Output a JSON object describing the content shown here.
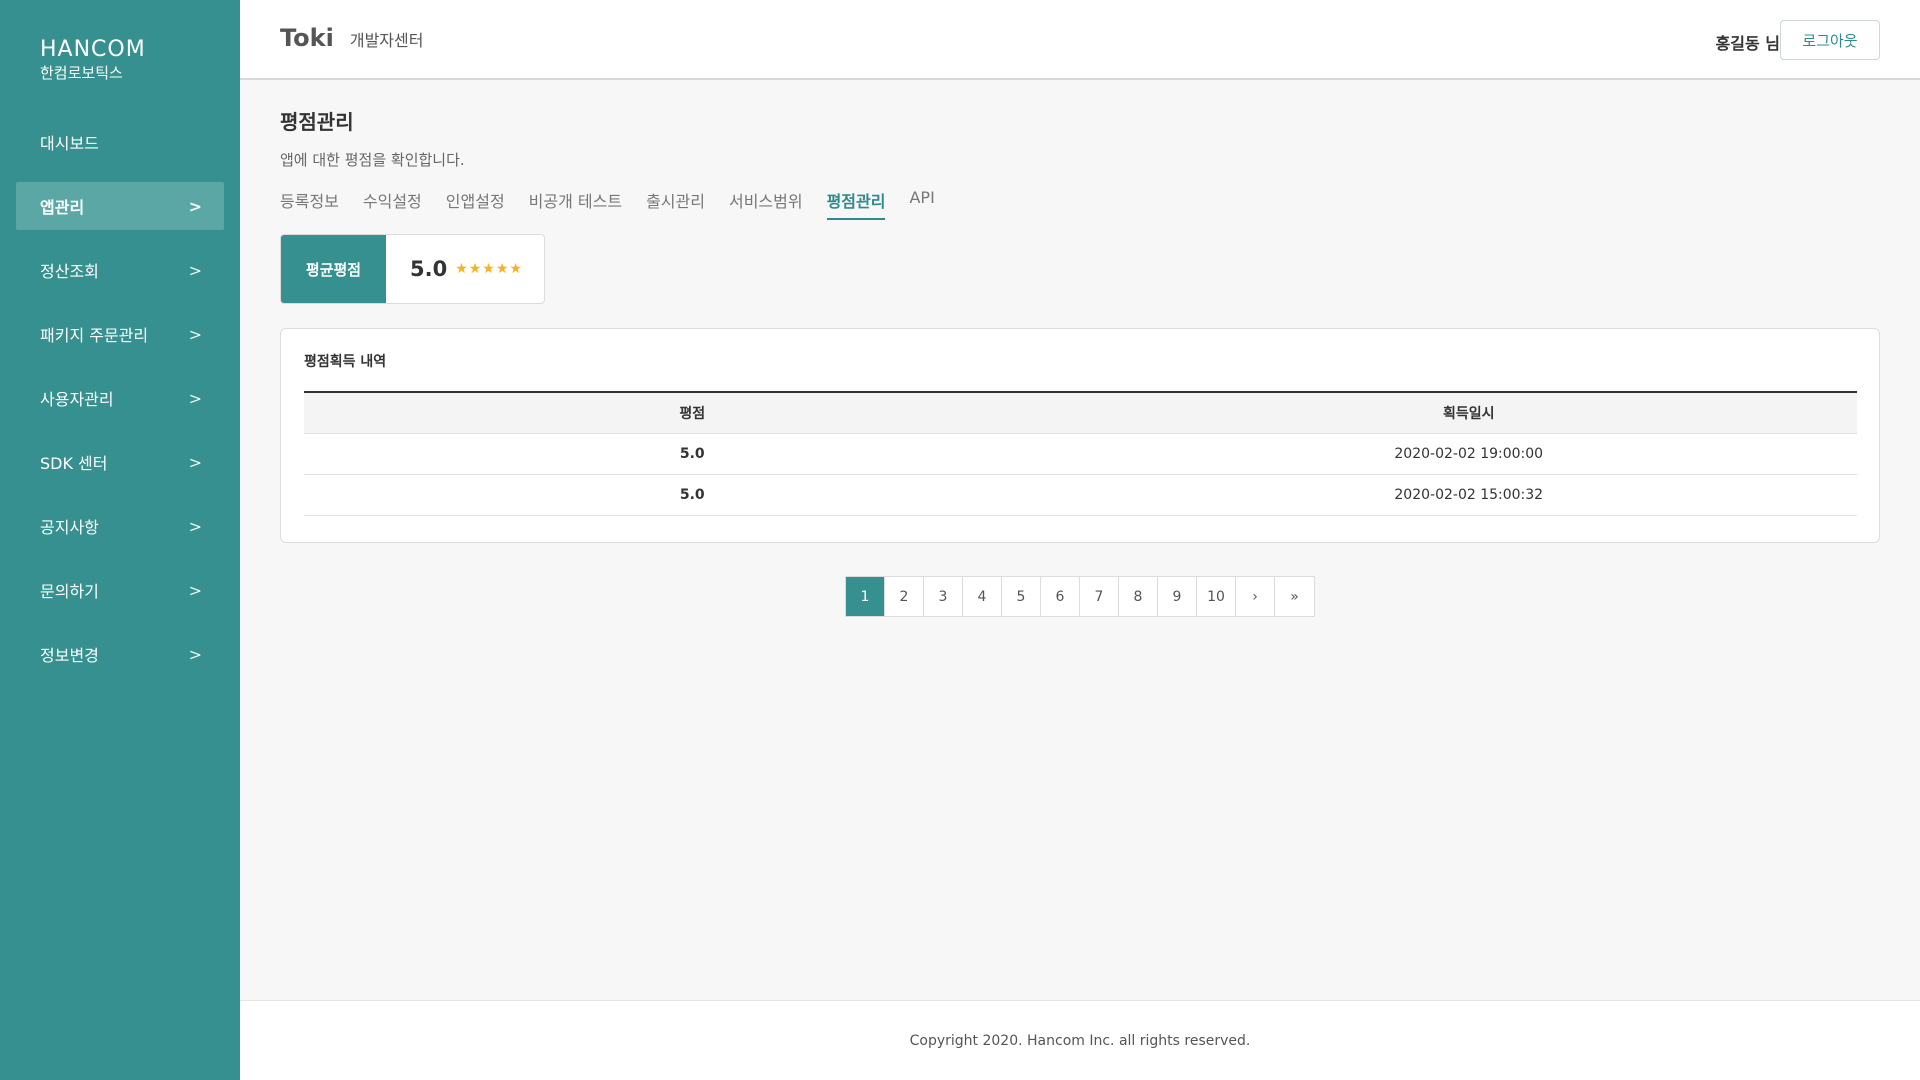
{
  "sidebar": {
    "logo_en": "HANCOM",
    "logo_ko": "한컴로보틱스",
    "items": [
      {
        "label": "대시보드",
        "chevron": ""
      },
      {
        "label": "앱관리",
        "chevron": ">"
      },
      {
        "label": "정산조회",
        "chevron": ">"
      },
      {
        "label": "패키지 주문관리",
        "chevron": ">"
      },
      {
        "label": "사용자관리",
        "chevron": ">"
      },
      {
        "label": "SDK 센터",
        "chevron": ">"
      },
      {
        "label": "공지사항",
        "chevron": ">"
      },
      {
        "label": "문의하기",
        "chevron": ">"
      },
      {
        "label": "정보변경",
        "chevron": ">"
      }
    ],
    "active_index": 1
  },
  "header": {
    "brand": "Toki",
    "brand_sub": "개발자센터",
    "user_name": "홍길동 님",
    "logout_label": "로그아웃"
  },
  "main": {
    "title": "평점관리",
    "description": "앱에 대한 평점을 확인합니다.",
    "tabs": [
      "등록정보",
      "수익설정",
      "인앱설정",
      "비공개 테스트",
      "출시관리",
      "서비스범위",
      "평점관리",
      "API"
    ],
    "active_tab": 6,
    "rating": {
      "label": "평균평점",
      "value": "5.0",
      "stars": "★★★★★",
      "star_count": 5
    },
    "panel": {
      "title": "평점획득 내역",
      "columns": [
        "평점",
        "획득일시"
      ],
      "rows": [
        [
          "5.0",
          "2020-02-02 19:00:00"
        ],
        [
          "5.0",
          "2020-02-02 15:00:32"
        ]
      ]
    },
    "pagination": {
      "pages": [
        "1",
        "2",
        "3",
        "4",
        "5",
        "6",
        "7",
        "8",
        "9",
        "10"
      ],
      "current": "1",
      "next": "›",
      "last": "»"
    }
  },
  "footer": {
    "copyright": "Copyright 2020. Hancom Inc. all rights reserved."
  },
  "colors": {
    "accent": "#36908f",
    "star": "#f4b321"
  }
}
